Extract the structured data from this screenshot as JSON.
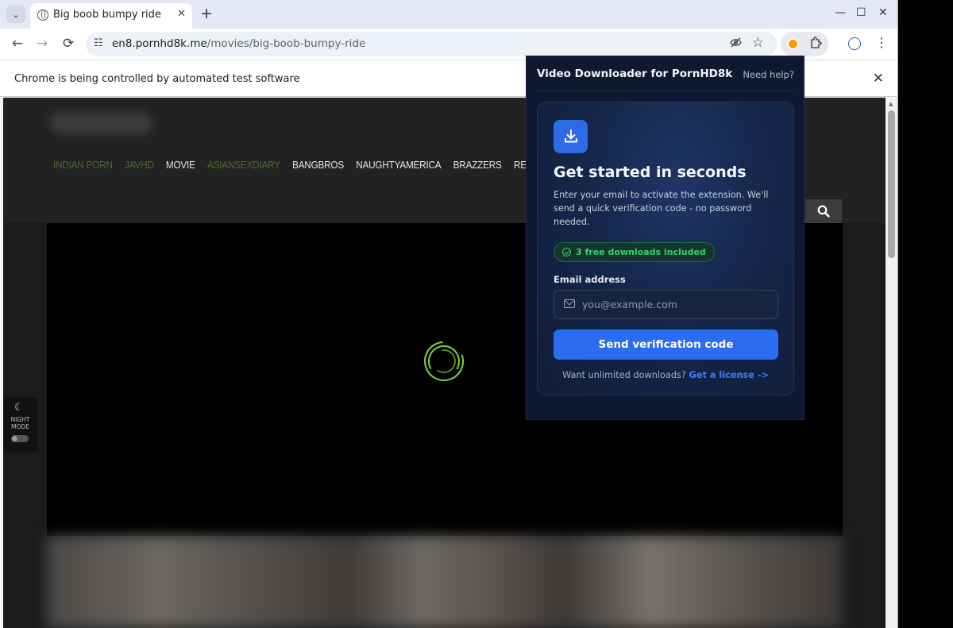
{
  "tab": {
    "title": "Big boob bumpy ride",
    "close": "✕",
    "new_tab": "+"
  },
  "window": {
    "minimize": "—",
    "maximize": "☐",
    "close": "✕"
  },
  "toolbar": {
    "back": "←",
    "forward": "→",
    "reload": "⟳",
    "url_host": "en8.pornhd8k.me",
    "url_path": "/movies/big-boob-bumpy-ride",
    "star": "☆",
    "menu": "⋮"
  },
  "infobar": {
    "message": "Chrome is being controlled by automated test software",
    "close": "✕"
  },
  "site": {
    "nav": [
      {
        "label": "INDIAN PORN",
        "dim": true
      },
      {
        "label": "JAVHD",
        "dim": true
      },
      {
        "label": "MOVIE",
        "dim": false
      },
      {
        "label": "ASIANSEXDIARY",
        "dim": true
      },
      {
        "label": "BANGBROS",
        "dim": false
      },
      {
        "label": "NAUGHTYAMERICA",
        "dim": false
      },
      {
        "label": "BRAZZERS",
        "dim": false
      },
      {
        "label": "REALITYKINGS",
        "dim": false
      }
    ],
    "night_mode_label": "NIGHT MODE"
  },
  "extension": {
    "title": "Video Downloader for PornHD8k",
    "help": "Need help?",
    "heading": "Get started in seconds",
    "description": "Enter your email to activate the extension. We'll send a quick verification code - no password needed.",
    "badge": "3 free downloads included",
    "email_label": "Email address",
    "email_placeholder": "you@example.com",
    "email_value": "",
    "button": "Send verification code",
    "upsell_text": "Want unlimited downloads?",
    "upsell_link": "Get a license ->"
  },
  "colors": {
    "accent": "#2b6cf0",
    "badge_green": "#2fd46d",
    "spinner": "#7fd13b",
    "popup_bg": "#0e1830"
  },
  "icons": [
    "tab-list-chevron-icon",
    "globe-icon",
    "tune-icon",
    "eye-off-icon",
    "star-icon",
    "extension-icon",
    "puzzle-icon",
    "profile-icon",
    "search-icon",
    "moon-icon",
    "download-icon",
    "check-circle-icon",
    "mail-icon"
  ]
}
